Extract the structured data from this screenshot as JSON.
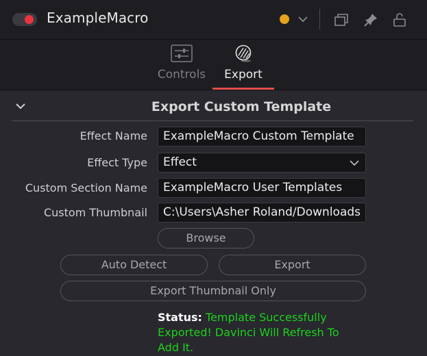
{
  "header": {
    "node_title": "ExampleMacro",
    "toggle_icon": "enable-toggle-icon",
    "color_dot": "#e5a21a",
    "chevron_icon": "chevron-down-icon",
    "icons": [
      "window-icon",
      "pin-icon",
      "lock-icon"
    ]
  },
  "tabs": [
    {
      "label": "Controls",
      "icon": "sliders-icon"
    },
    {
      "label": "Export",
      "icon": "export-ball-icon"
    }
  ],
  "active_tab": "Export",
  "accent_color": "#e44c4c",
  "section": {
    "title": "Export Custom Template"
  },
  "form": {
    "effect_name": {
      "label": "Effect Name",
      "value": "ExampleMacro Custom Template"
    },
    "effect_type": {
      "label": "Effect Type",
      "value": "Effect"
    },
    "custom_section": {
      "label": "Custom Section Name",
      "value": "ExampleMacro User Templates"
    },
    "thumbnail": {
      "label": "Custom Thumbnail",
      "value": "C:\\Users\\Asher Roland/Downloads/"
    }
  },
  "buttons": {
    "browse": "Browse",
    "auto_detect": "Auto Detect",
    "export": "Export",
    "export_thumbnail": "Export Thumbnail Only"
  },
  "status": {
    "label": "Status:",
    "message": "Template Successfully Exported! Davinci Will Refresh To Add It.",
    "color": "#1cd31c"
  }
}
